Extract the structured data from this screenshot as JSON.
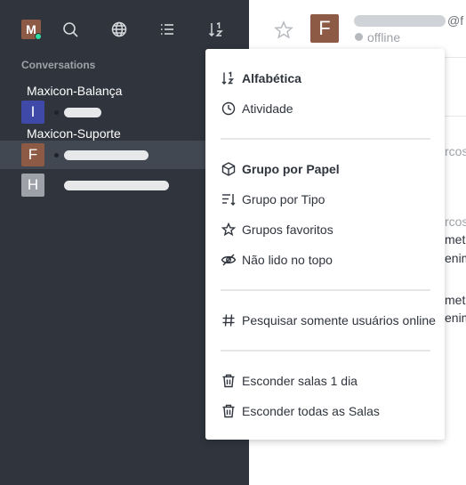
{
  "sidebar": {
    "me_avatar_letter": "M",
    "section_label": "Conversations",
    "groups": [
      {
        "title": "Maxicon-Balança"
      },
      {
        "title": "Maxicon-Suporte"
      }
    ],
    "rooms": [
      {
        "letter": "I",
        "color": "#3f4aa8"
      },
      {
        "letter": "F",
        "color": "#8d5a45"
      },
      {
        "letter": "H",
        "color": "#9ea2a8"
      }
    ],
    "icons": [
      "search-icon",
      "globe-icon",
      "list-icon",
      "sort-icon"
    ]
  },
  "header": {
    "avatar_letter": "F",
    "username_prefix": "@f",
    "status": "offline"
  },
  "background_fragments": [
    "rcos.",
    "rcos.",
    "met,",
    "enim",
    "met,",
    "enim"
  ],
  "menu": {
    "sort_items": [
      {
        "label": "Alfabética",
        "icon": "sort-alpha-icon",
        "bold": true
      },
      {
        "label": "Atividade",
        "icon": "clock-icon",
        "bold": false
      }
    ],
    "group_items": [
      {
        "label": "Grupo por Papel",
        "icon": "cube-icon",
        "bold": true
      },
      {
        "label": "Grupo por Tipo",
        "icon": "sort-lines-icon",
        "bold": false
      },
      {
        "label": "Grupos favoritos",
        "icon": "star-icon",
        "bold": false
      },
      {
        "label": "Não lido no topo",
        "icon": "eye-off-icon",
        "bold": false
      }
    ],
    "search_items": [
      {
        "label": "Pesquisar somente usuários online",
        "icon": "hashtag-icon",
        "bold": false
      }
    ],
    "hide_items": [
      {
        "label": "Esconder salas 1 dia",
        "icon": "trash-icon",
        "bold": false
      },
      {
        "label": "Esconder todas as Salas",
        "icon": "trash-icon",
        "bold": false
      }
    ]
  },
  "colors": {
    "sidebar_bg": "#2f343d",
    "active_row": "#414852",
    "online": "#2de0a5",
    "avatar_brown": "#8d5a45",
    "avatar_blue": "#3f4aa8",
    "avatar_gray": "#9ea2a8"
  }
}
